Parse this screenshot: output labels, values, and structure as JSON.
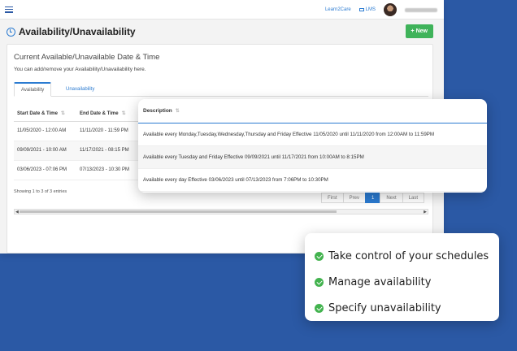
{
  "topbar": {
    "link1": "Learn2Care",
    "link2": "LMS"
  },
  "page": {
    "title": "Availability/Unavailability",
    "new_button": "New"
  },
  "card": {
    "title": "Current Available/Unavailable Date & Time",
    "subtitle": "You can add/remove your Availability/Unavailability here."
  },
  "tabs": [
    "Availability",
    "Unavailability"
  ],
  "table": {
    "columns": [
      "Start Date & Time",
      "End Date & Time"
    ],
    "rows": [
      [
        "11/05/2020 - 12:00 AM",
        "11/11/2020 - 11:59 PM"
      ],
      [
        "09/09/2021 - 10:00 AM",
        "11/17/2021 - 08:15 PM"
      ],
      [
        "03/06/2023 - 07:06 PM",
        "07/13/2023 - 10:30 PM"
      ]
    ],
    "showing": "Showing 1 to 3 of 3 entries"
  },
  "pager": {
    "first": "First",
    "prev": "Prev",
    "current": "1",
    "next": "Next",
    "last": "Last"
  },
  "description": {
    "header": "Description",
    "rows": [
      "Available every Monday,Tuesday,Wednesday,Thursday and Friday Effective 11/05/2020 until 11/11/2020 from 12:00AM to 11:59PM",
      "Available every Tuesday and Friday Effective 09/09/2021 until 11/17/2021 from 10:00AM to 8:15PM",
      "Available every day Effective 03/06/2023 until 07/13/2023 from 7:06PM to 10:30PM"
    ]
  },
  "features": [
    "Take control of your schedules",
    "Manage availability",
    "Specify unavailability"
  ],
  "colors": {
    "brand_blue": "#2b59a5",
    "link_blue": "#2b7bd1",
    "new_green": "#3fb35a",
    "check_green": "#43b34f"
  }
}
